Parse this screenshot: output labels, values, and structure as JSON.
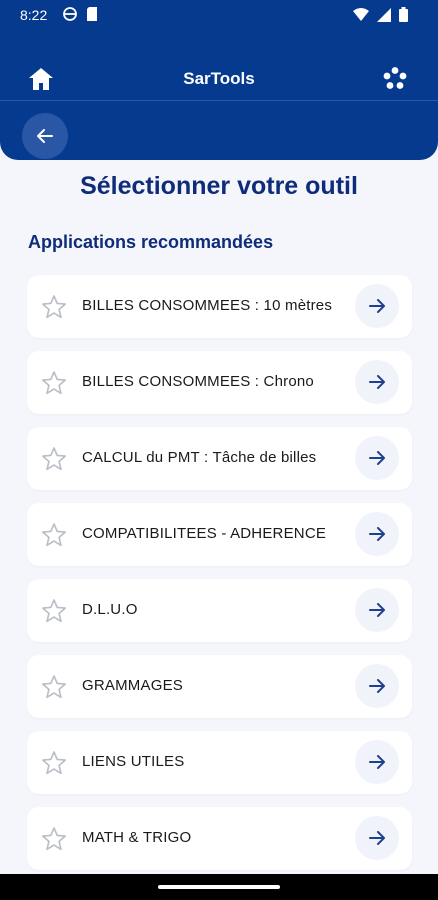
{
  "status_bar": {
    "time": "8:22",
    "left_icons": [
      "vpn-icon",
      "sim-icon"
    ],
    "right_icons": [
      "wifi-icon",
      "signal-icon",
      "battery-icon"
    ]
  },
  "header": {
    "title": "SarTools",
    "home_icon": "home-icon",
    "settings_icon": "cog-icon",
    "back_icon": "arrow-left-icon",
    "background": "#063a8f"
  },
  "page": {
    "title": "Sélectionner votre outil",
    "section_title": "Applications recommandées"
  },
  "tools": [
    {
      "label": "BILLES CONSOMMEES : 10 mètres"
    },
    {
      "label": "BILLES CONSOMMEES : Chrono"
    },
    {
      "label": "CALCUL du PMT  : Tâche de billes"
    },
    {
      "label": "COMPATIBILITEES - ADHERENCE"
    },
    {
      "label": "D.L.U.O"
    },
    {
      "label": "GRAMMAGES"
    },
    {
      "label": "LIENS UTILES"
    },
    {
      "label": "MATH & TRIGO"
    }
  ],
  "colors": {
    "primary": "#063a8f",
    "title_text": "#0f2c7a",
    "background": "#f4f6fb"
  }
}
